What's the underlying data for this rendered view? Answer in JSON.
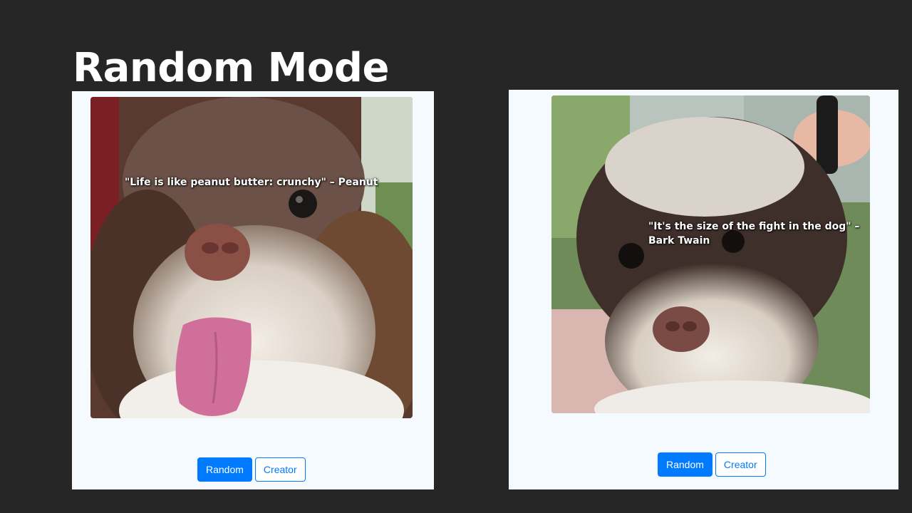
{
  "slide": {
    "title": "Random Mode"
  },
  "panels": [
    {
      "quote": "\"Life is like peanut butter: crunchy\"  –  Peanut",
      "random_label": "Random",
      "creator_label": "Creator"
    },
    {
      "quote": "\"It's the size of the fight in the dog\"  –  Bark Twain",
      "random_label": "Random",
      "creator_label": "Creator"
    }
  ],
  "colors": {
    "background": "#262626",
    "panel": "#f4fafd",
    "primary": "#007bff"
  }
}
